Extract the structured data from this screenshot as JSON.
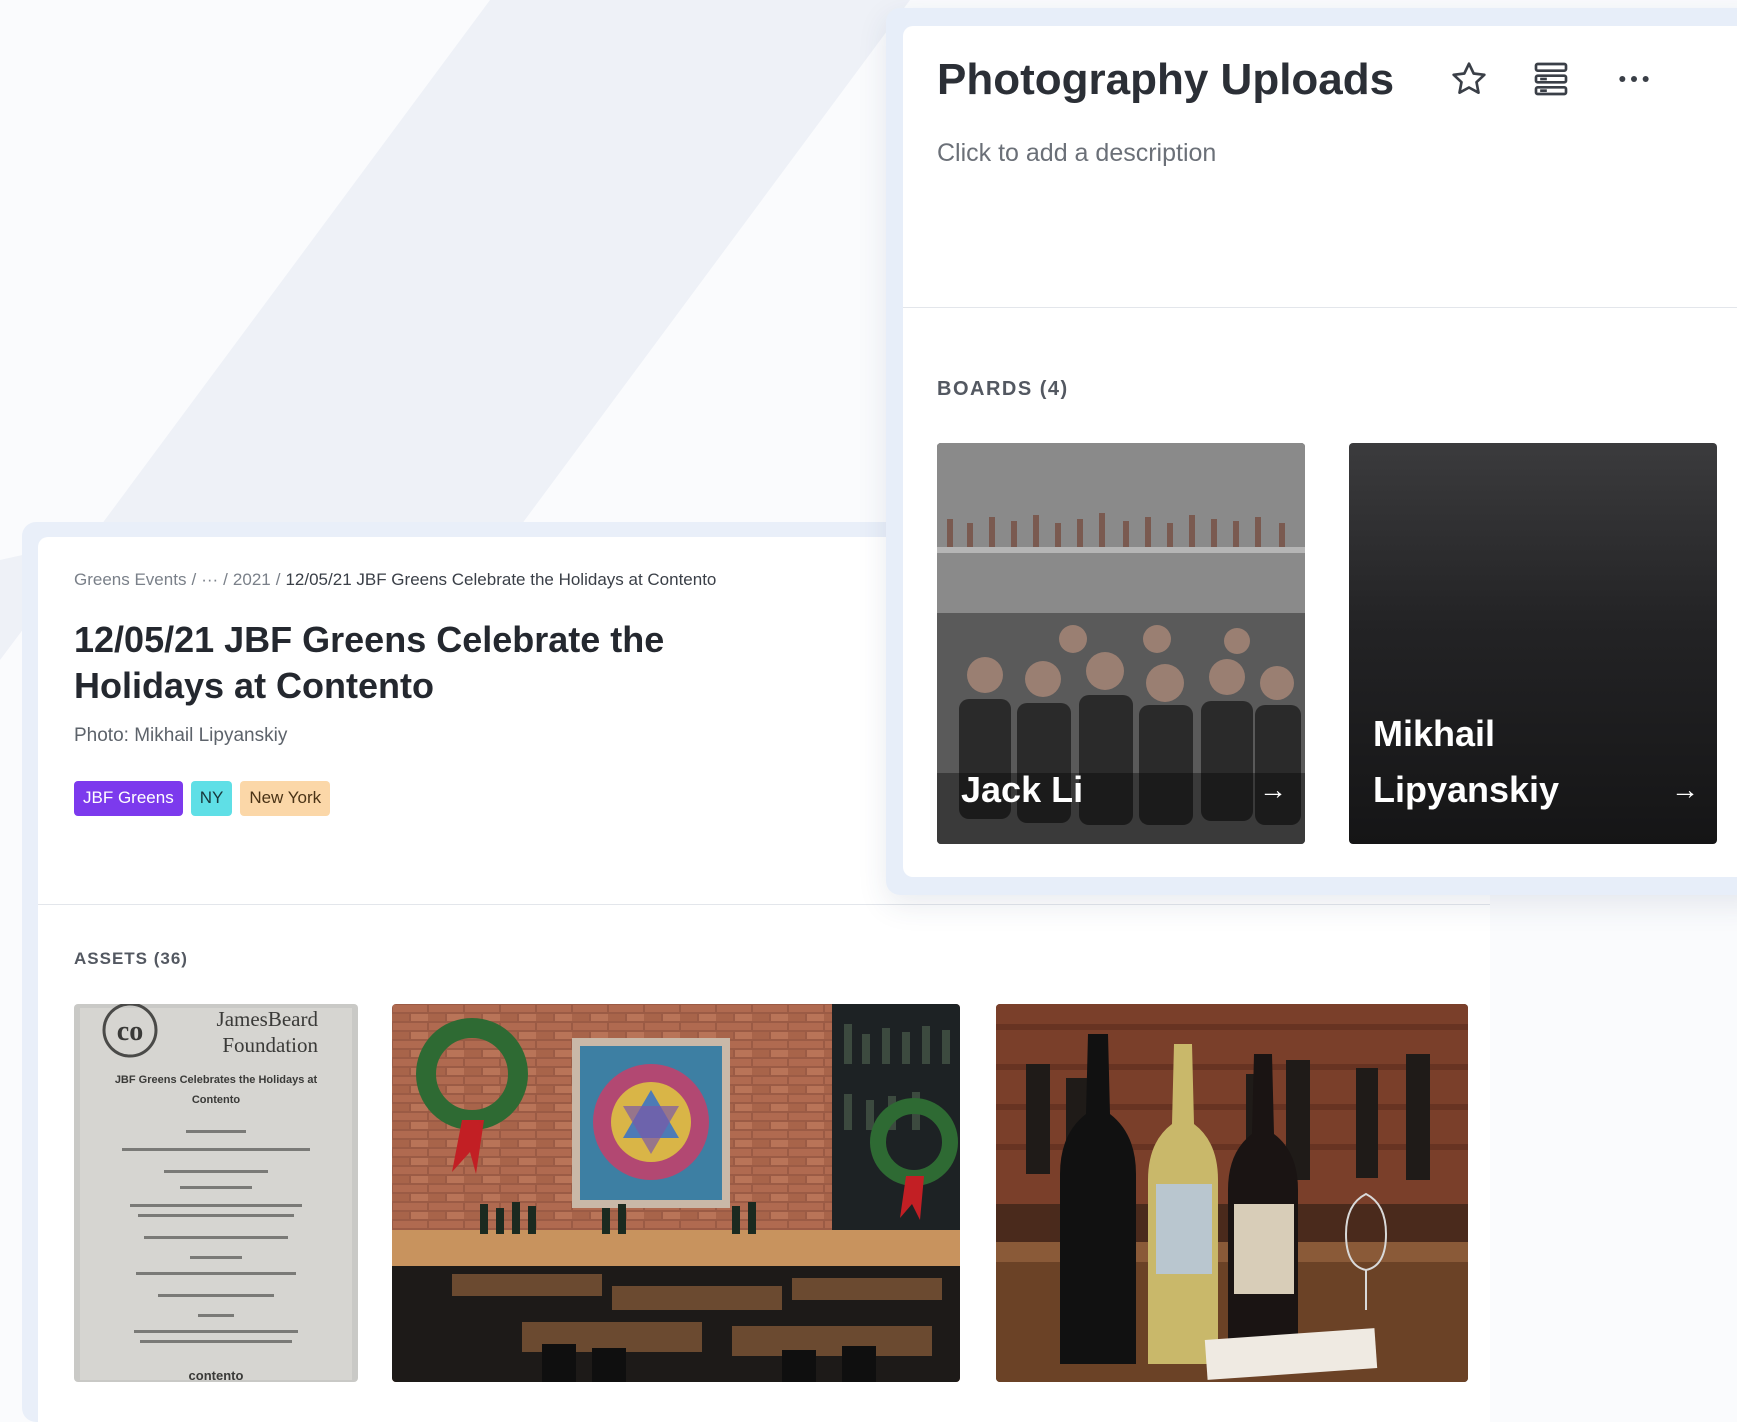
{
  "asset": {
    "breadcrumb": {
      "root": "Greens Events",
      "ellipsis": "···",
      "year": "2021",
      "current": "12/05/21 JBF Greens Celebrate the Holidays at Contento"
    },
    "title": "12/05/21 JBF Greens Celebrate the Holidays at Contento",
    "photo_credit": "Photo: Mikhail Lipyanskiy",
    "tags": [
      {
        "label": "JBF Greens",
        "color": "#7c3aed"
      },
      {
        "label": "NY",
        "color": "#5fdfe6"
      },
      {
        "label": "New York",
        "color": "#fbd7a8"
      }
    ],
    "assets_label": "ASSETS (36)",
    "menu_card": {
      "logo": "co",
      "brand_line1": "JamesBeard",
      "brand_line2": "Foundation",
      "heading_line1": "JBF Greens Celebrates the Holidays at",
      "heading_line2": "Contento",
      "footer": "contento"
    }
  },
  "collection": {
    "title": "Photography Uploads",
    "description_placeholder": "Click to add a description",
    "icons": [
      "star-icon",
      "layout-icon",
      "more-icon"
    ],
    "boards_label": "BOARDS (4)",
    "boards": [
      {
        "name": "Jack Li",
        "arrow": "→"
      },
      {
        "name": "Mikhail Lipyanskiy",
        "arrow": "→"
      }
    ]
  }
}
